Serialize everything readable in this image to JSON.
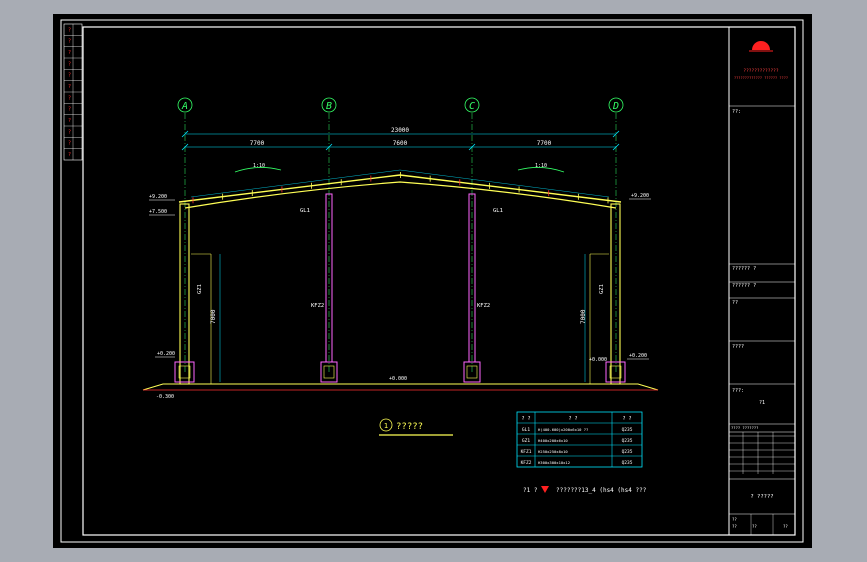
{
  "title_block": {
    "company_line1": "?????????????",
    "company_line2": "????????????? ?????? ????",
    "cells": [
      "??:",
      "?????? ?",
      "?????? ?",
      "??",
      "????",
      "???:",
      "?1",
      "????  ???????"
    ],
    "drawing_name": "? ?????",
    "footer": [
      "??",
      "??",
      "??",
      "??"
    ]
  },
  "side_strip": {
    "labels": [
      "?",
      "?",
      "?",
      "?",
      "?",
      "?",
      "?",
      "?",
      "?",
      "?",
      "?",
      "?"
    ]
  },
  "axes": [
    {
      "id": "A"
    },
    {
      "id": "B"
    },
    {
      "id": "C"
    },
    {
      "id": "D"
    }
  ],
  "dimensions": {
    "overall": "23000",
    "bays": [
      "7700",
      "7600",
      "7700"
    ],
    "slope_left": "1:10",
    "slope_right": "1:10",
    "height_left": "7000",
    "height_right": "7000"
  },
  "elevations": {
    "eave_left_top": "+9.200",
    "eave_left_bottom": "+7.500",
    "eave_right": "+9.200",
    "ground_left": "+0.200",
    "ground_right": "+0.200",
    "ground_inner_right": "+0.000",
    "floor_center": "+0.000",
    "bottom_left": "-0.300"
  },
  "member_labels": {
    "beam_left": "GL1",
    "beam_right": "GL1",
    "col_left": "GZ1",
    "col_right": "GZ1",
    "col_mid_left": "KFZ2",
    "col_mid_right": "KFZ2"
  },
  "section_title": "?????",
  "section_number": "1",
  "member_table": {
    "header": [
      "? ?",
      "? ?",
      "? ?"
    ],
    "rows": [
      [
        "GL1",
        "H(400-600)x200x6x10 ??",
        "Q235"
      ],
      [
        "GZ1",
        "H400x200x6x10",
        "Q235"
      ],
      [
        "KFZ1",
        "H250x250x8x10",
        "Q235"
      ],
      [
        "KFZ2",
        "H300x300x10x12",
        "Q235"
      ]
    ]
  },
  "note": {
    "prefix": "?1 ?",
    "text": "???????13_4 (hs4 (hs4 ???"
  },
  "colors": {
    "background": "#000000",
    "border": "#ffffff",
    "dimension": "#00e5ff",
    "structure": "#ffff55",
    "member": "#ff66ff",
    "axis": "#33ff66",
    "note": "#ff3030",
    "accent": "#ff2020"
  }
}
